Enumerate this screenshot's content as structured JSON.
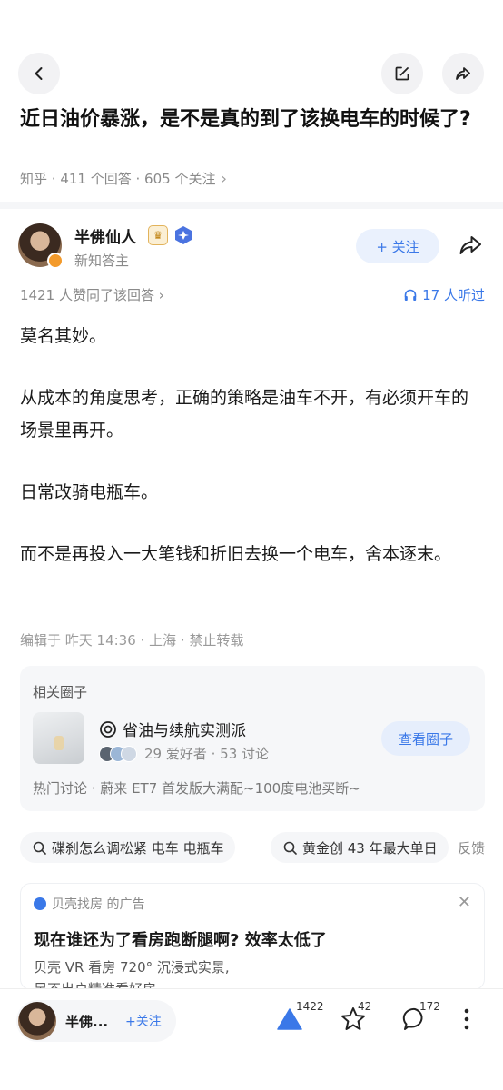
{
  "question": {
    "title": "近日油价暴涨，是不是真的到了该换电车的时候了?",
    "source": "知乎",
    "answers": "411 个回答",
    "followers": "605 个关注",
    "chevron": "›"
  },
  "author": {
    "name": "半佛仙人",
    "subtitle": "新知答主",
    "follow_label": "+ 关注"
  },
  "stats": {
    "agree_text": "1421 人赞同了该回答 ›",
    "listen_text": "17 人听过"
  },
  "answer": {
    "paragraphs": [
      "莫名其妙。",
      "从成本的角度思考，正确的策略是油车不开，有必须开车的场景里再开。",
      "日常改骑电瓶车。",
      "而不是再投入一大笔钱和折旧去换一个电车，舍本逐末。"
    ],
    "edit_info": "编辑于 昨天 14:36 · 上海 · 禁止转载"
  },
  "circle": {
    "header": "相关圈子",
    "name": "省油与续航实测派",
    "members": "29 爱好者 · 53 讨论",
    "button": "查看圈子",
    "hot": "热门讨论 · 蔚来 ET7 首发版大满配~100度电池买断~"
  },
  "searches": {
    "chips": [
      "碟刹怎么调松紧 电车 电瓶车",
      "黄金创 43 年最大单日"
    ],
    "feedback": "反馈"
  },
  "ad": {
    "source": "贝壳找房 的广告",
    "title": "现在谁还为了看房跑断腿啊? 效率太低了",
    "line1": "贝壳 VR 看房 720° 沉浸式实景,",
    "line2": "足不出户精准看好房"
  },
  "bottom": {
    "name": "半佛...",
    "follow": "+关注",
    "agree_count": "1422",
    "star_count": "42",
    "comment_count": "172"
  },
  "colors": {
    "accent": "#3a78e8",
    "muted": "#8a8a8a",
    "background": "#ffffff",
    "panel": "#f6f7f9"
  },
  "icons": {
    "back": "back-icon",
    "edit": "edit-icon",
    "share": "share-icon",
    "crown": "crown-badge-icon",
    "verified": "verified-badge-icon",
    "headphones": "headphones-icon",
    "circle": "circle-icon",
    "search": "search-icon",
    "close": "close-icon",
    "agree": "agree-triangle-icon",
    "star": "star-icon",
    "comment": "comment-icon",
    "more": "more-icon"
  }
}
